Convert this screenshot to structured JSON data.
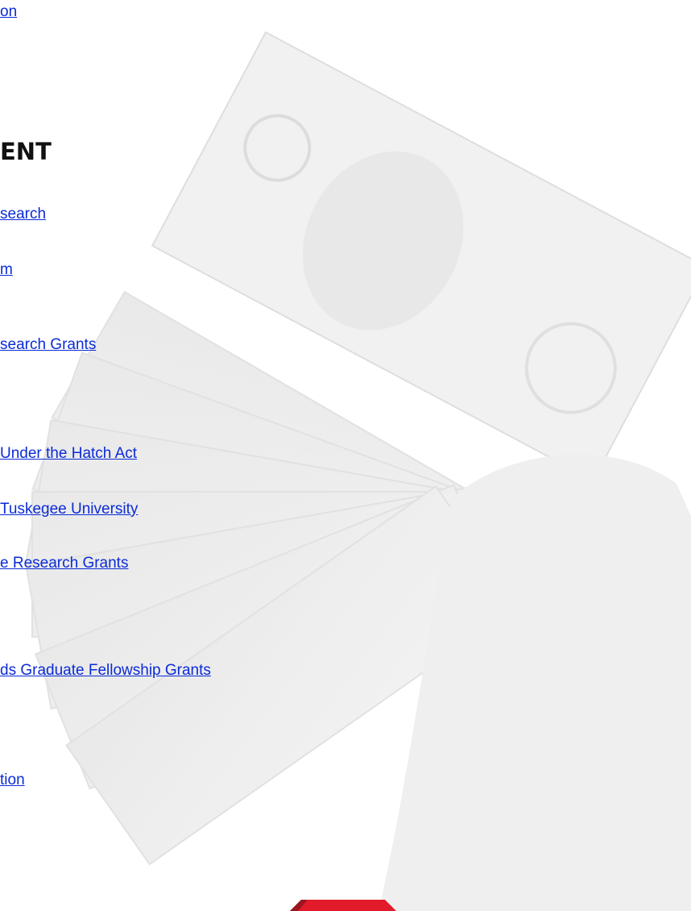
{
  "links": {
    "top": "on",
    "research": "search",
    "program": "m",
    "research_grants": "search Grants",
    "hatch_act": " Under the Hatch Act",
    "tuskegee": "Tuskegee University",
    "research_grants_2": "e Research Grants",
    "fellowship": "ds Graduate Fellowship Grants",
    "bottom": "tion"
  },
  "section": {
    "heading": "ENT"
  },
  "background": {
    "image_icon": "banknotes-photo",
    "tint": "#f4f4f4"
  },
  "brand": {
    "accent": "#e21b2a"
  }
}
